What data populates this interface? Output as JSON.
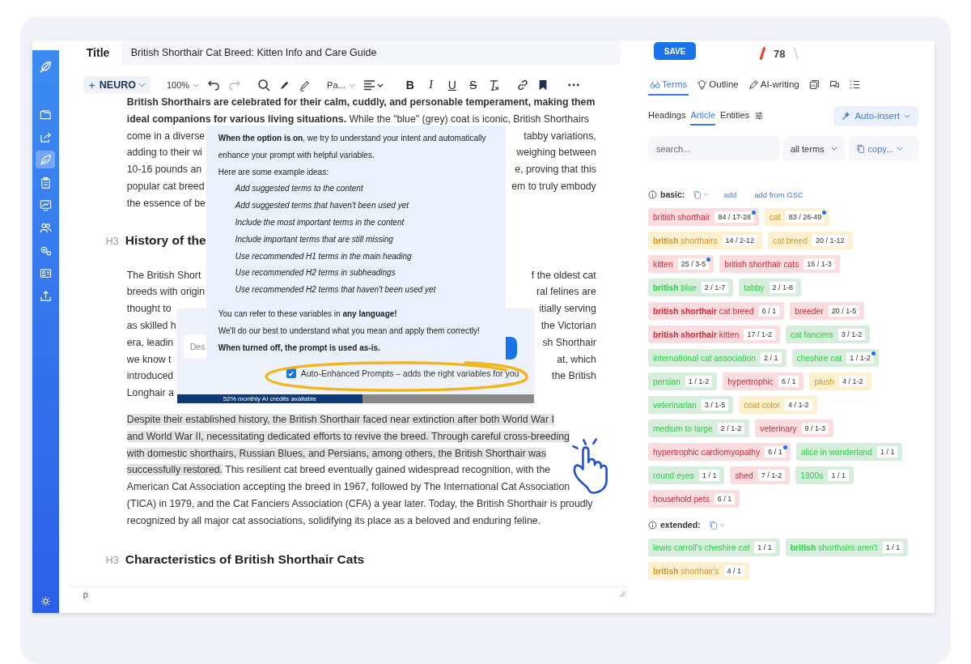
{
  "sidebar": {
    "items": [
      {
        "kind": "folder",
        "selected": false
      },
      {
        "kind": "share",
        "selected": false
      },
      {
        "kind": "leaf",
        "selected": true
      },
      {
        "kind": "clipboard",
        "selected": false
      },
      {
        "kind": "chart",
        "selected": false
      },
      {
        "kind": "users",
        "selected": false
      },
      {
        "kind": "gears",
        "selected": false
      },
      {
        "kind": "card",
        "selected": false
      },
      {
        "kind": "upload",
        "selected": false
      }
    ]
  },
  "editor": {
    "title_label": "Title",
    "title_value": "British Shorthair Cat Breed: Kitten Info and Care Guide",
    "toolbar": {
      "brand": "NEURO",
      "zoom": "100%",
      "style": "Pa...",
      "format": [
        {
          "label": "B",
          "kind": "bold"
        },
        {
          "label": "I",
          "kind": "italic"
        },
        {
          "label": "U",
          "kind": "underline"
        },
        {
          "label": "S",
          "kind": "strike"
        }
      ]
    },
    "blocks": [
      {
        "kind": "paragraph",
        "lines": [
          {
            "kind": "full",
            "text": "**British Shorthairs are celebrated for their calm, cuddly, and personable temperament, making them**"
          },
          {
            "kind": "full",
            "text": "**ideal companions for various living situations.** While the \"blue\" (grey) coat is iconic, British Shorthairs"
          },
          {
            "kind": "split",
            "left": "come in a diverse",
            "right": "tabby variations,"
          },
          {
            "kind": "split",
            "left": "adding to their wi",
            "right": "weighing between"
          },
          {
            "kind": "split",
            "left": "10-16 pounds an",
            "right": "e, proving that this"
          },
          {
            "kind": "split",
            "left": "popular cat breed",
            "right": "em to truly embody"
          },
          {
            "kind": "split",
            "left": "the essence of be"
          }
        ]
      },
      {
        "kind": "heading",
        "level": "H3",
        "text": "History of the"
      },
      {
        "kind": "paragraph",
        "lines": [
          {
            "kind": "split",
            "left": "The British Short",
            "right": "f the oldest cat"
          },
          {
            "kind": "split",
            "left": "breeds with origin",
            "right": "ral felines are"
          },
          {
            "kind": "split",
            "left": "thought to",
            "right": "itially serving"
          },
          {
            "kind": "split",
            "left": "as skilled h",
            "right": "the Victorian"
          },
          {
            "kind": "split",
            "left": "era, leadin",
            "right": "sh Shorthair"
          },
          {
            "kind": "split",
            "left": "we know t",
            "right": "at, which"
          },
          {
            "kind": "split",
            "left": "introduced",
            "right": "the British"
          },
          {
            "kind": "split",
            "left": "Longhair a"
          }
        ]
      },
      {
        "kind": "paragraph",
        "lines": [
          {
            "kind": "marked",
            "spans": [
              {
                "text": "Despite their established history, the British Shorthair faced near extinction after both World War I",
                "highlighted": true
              }
            ]
          },
          {
            "kind": "marked",
            "spans": [
              {
                "text": "and World War II, necessitating dedicated efforts to revive the breed. Through careful cross-breeding",
                "highlighted": true
              }
            ]
          },
          {
            "kind": "marked",
            "spans": [
              {
                "text": "with domestic shorthairs, Russian Blues, and Persians, among others, the British Shorthair was",
                "highlighted": true
              }
            ]
          },
          {
            "kind": "marked",
            "spans": [
              {
                "text": "successfully restored.",
                "highlighted": true
              },
              {
                "text": " This resilient cat breed eventually gained widespread recognition, with the",
                "highlighted": false
              }
            ]
          },
          {
            "kind": "full",
            "text": "American Cat Association accepting the breed in 1967, followed by The International Cat Association"
          },
          {
            "kind": "full",
            "text": "(TICA) in 1979, and the Cat Fanciers Association (CFA) a year later. Today, the British Shorthair is proudly"
          },
          {
            "kind": "full",
            "text": "recognized by all major cat associations, solidifying its place as a beloved and enduring feline."
          }
        ]
      },
      {
        "kind": "heading",
        "level": "H3",
        "text": "Characteristics of British Shorthair Cats"
      }
    ],
    "status": "p"
  },
  "prompt_panel": {
    "placeholder": "Des",
    "checkbox": {
      "label": "Auto-Enhanced Prompts – adds the right variables for you",
      "checked": true
    },
    "credits": {
      "label": "52% monthly AI credits available",
      "level": 0.52
    }
  },
  "tooltip": {
    "intro": [
      "**When the option is on**, we try to understand your intent and automatically enhance your prompt with helpful variables.",
      "Here are some example ideas:"
    ],
    "ideas": [
      "Add suggested terms to the content",
      "Add suggested terms that haven't been used yet",
      "Include the most important terms in the content",
      "Include important terms that are still missing",
      "Use recommended H1 terms in the main heading",
      "Use recommended H2 terms in subheadings",
      "Use recommended H2 terms that haven't been used yet"
    ],
    "notes": [
      {
        "text": "You can refer to these variables in **any language!**",
        "kind": "plain"
      },
      {
        "text": "We'll do our best to understand what you mean and apply them correctly!",
        "kind": "plain"
      },
      {
        "text": "When turned off, the prompt is used as-is.",
        "kind": "strong"
      }
    ]
  },
  "panel": {
    "save": "SAVE",
    "score": "78",
    "tabs": [
      {
        "kind": "terms",
        "label": "Terms",
        "selected": true
      },
      {
        "kind": "outline",
        "label": "Outline",
        "selected": false
      },
      {
        "kind": "writing",
        "label": "AI-writing",
        "selected": false
      },
      {
        "kind": "gallery",
        "selected": false
      },
      {
        "kind": "chat",
        "selected": false
      },
      {
        "kind": "list",
        "selected": false
      }
    ],
    "subtabs": [
      {
        "label": "Headings",
        "selected": false
      },
      {
        "label": "Article",
        "selected": true
      },
      {
        "label": "Entities",
        "selected": false
      }
    ],
    "auto_insert": "Auto-insert",
    "search_placeholder": "search...",
    "filter": "all terms",
    "copy": "copy...",
    "term_groups": [
      {
        "label": "basic:",
        "actions": [
          "add",
          "add from GSC"
        ],
        "terms": [
          {
            "text": "british shorthair",
            "count": "84 / 17-28",
            "color": "#fbdde0",
            "dot": true
          },
          {
            "text": "cat",
            "count": "83 / 26-49",
            "color": "#fcf0cf",
            "dot": true
          },
          {
            "text": "**british** shorthairs",
            "count": "14 / 2-12",
            "color": "#fcf0cf",
            "dot": false
          },
          {
            "text": "cat breed",
            "count": "20 / 1-12",
            "color": "#fcf0cf",
            "dot": false
          },
          {
            "text": "kitten",
            "count": "25 / 3-5",
            "color": "#fbdde0",
            "dot": true
          },
          {
            "text": "british shorthair cats",
            "count": "16 / 1-3",
            "color": "#fbdde0",
            "dot": false
          },
          {
            "text": "**british** blue",
            "count": "2 / 1-7",
            "color": "#d6eedb",
            "dot": false
          },
          {
            "text": "tabby",
            "count": "2 / 1-8",
            "color": "#d6eedb",
            "dot": false
          },
          {
            "text": "**british shorthair** cat breed",
            "count": "6 / 1",
            "color": "#fbdde0",
            "dot": false
          },
          {
            "text": "breeder",
            "count": "20 / 1-5",
            "color": "#fbdde0",
            "dot": false
          },
          {
            "text": "**british shorthair** kitten",
            "count": "17 / 1-2",
            "color": "#fbdde0",
            "dot": false
          },
          {
            "text": "cat fanciers",
            "count": "3 / 1-2",
            "color": "#d6eedb",
            "dot": false
          },
          {
            "text": "international cat association",
            "count": "2 / 1",
            "color": "#d6eedb",
            "dot": false
          },
          {
            "text": "cheshire cat",
            "count": "1 / 1-2",
            "color": "#d6eedb",
            "dot": true
          },
          {
            "text": "persian",
            "count": "1 / 1-2",
            "color": "#d6eedb",
            "dot": false
          },
          {
            "text": "hypertrophic",
            "count": "6 / 1",
            "color": "#fbdde0",
            "dot": false
          },
          {
            "text": "plush",
            "count": "4 / 1-2",
            "color": "#fcf0cf",
            "dot": false
          },
          {
            "text": "veterinarian",
            "count": "3 / 1-5",
            "color": "#d6eedb",
            "dot": false
          },
          {
            "text": "coat color",
            "count": "4 / 1-2",
            "color": "#fcf0cf",
            "dot": false
          },
          {
            "text": "medium to large",
            "count": "2 / 1-2",
            "color": "#d6eedb",
            "dot": false
          },
          {
            "text": "veterinary",
            "count": "9 / 1-3",
            "color": "#fbdde0",
            "dot": false
          },
          {
            "text": "hypertrophic cardiomyopathy",
            "count": "6 / 1",
            "color": "#fbdde0",
            "dot": true
          },
          {
            "text": "alice in wonderland",
            "count": "1 / 1",
            "color": "#d6eedb",
            "dot": false
          },
          {
            "text": "round eyes",
            "count": "1 / 1",
            "color": "#d6eedb",
            "dot": false
          },
          {
            "text": "shed",
            "count": "7 / 1-2",
            "color": "#fbdde0",
            "dot": false
          },
          {
            "text": "1900s",
            "count": "1 / 1",
            "color": "#d6eedb",
            "dot": false
          },
          {
            "text": "household pets",
            "count": "6 / 1",
            "color": "#fbdde0",
            "dot": false
          }
        ]
      },
      {
        "label": "extended:",
        "terms": [
          {
            "text": "lewis carroll's cheshire cat",
            "count": "1 / 1",
            "color": "#d6eedb",
            "dot": false
          },
          {
            "text": "**british** shorthairs aren't",
            "count": "1 / 1",
            "color": "#d6eedb",
            "dot": false
          },
          {
            "text": "**british** shorthair's",
            "count": "4 / 1",
            "color": "#fcf0cf",
            "dot": false
          }
        ]
      }
    ]
  }
}
